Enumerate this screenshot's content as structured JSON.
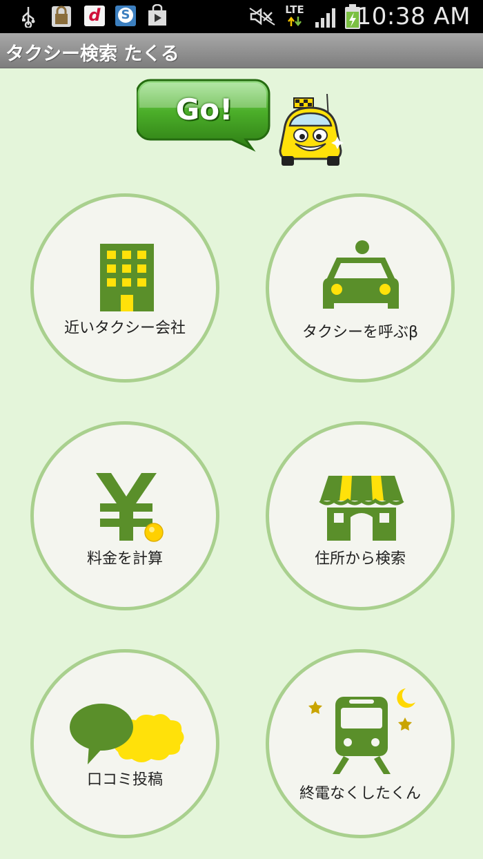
{
  "status_bar": {
    "network": "LTE",
    "time": "10:38 AM",
    "icons": [
      "usb-icon",
      "lock-app-icon",
      "d-menu-icon",
      "s-app-icon",
      "play-store-icon",
      "mute-icon",
      "signal-icon",
      "battery-charging-icon"
    ],
    "d_letter": "d",
    "s_letter": "S"
  },
  "app": {
    "title": "タクシー検索 たくる"
  },
  "banner": {
    "go_text": "Go!"
  },
  "menu": [
    {
      "id": "nearby",
      "label": "近いタクシー会社",
      "icon": "building-icon"
    },
    {
      "id": "call",
      "label": "タクシーを呼ぶβ",
      "icon": "taxi-icon"
    },
    {
      "id": "fare",
      "label": "料金を計算",
      "icon": "yen-icon"
    },
    {
      "id": "address",
      "label": "住所から検索",
      "icon": "shop-icon"
    },
    {
      "id": "review",
      "label": "口コミ投稿",
      "icon": "speech-bubbles-icon"
    },
    {
      "id": "lasttrain",
      "label": "終電なくしたくん",
      "icon": "train-icon"
    }
  ],
  "colors": {
    "background": "#e4f5da",
    "circle_border": "#a9d08e",
    "icon_green": "#5a8f2a",
    "icon_yellow": "#ffe10a"
  }
}
